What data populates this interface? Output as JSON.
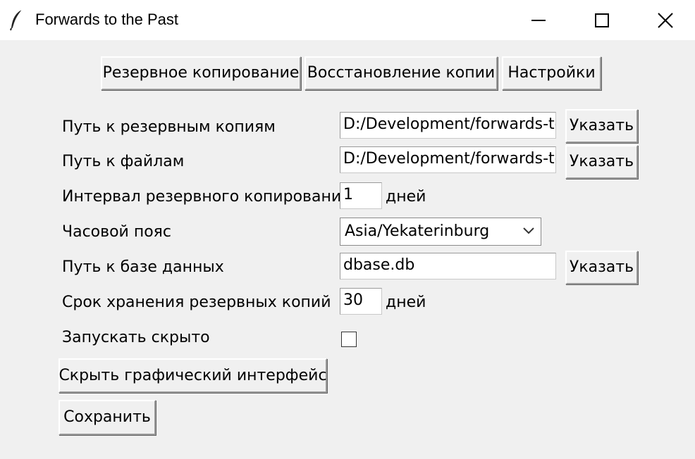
{
  "window": {
    "title": "Forwards to the Past",
    "icon": "feather-icon",
    "controls": [
      "minimize-icon",
      "maximize-icon",
      "close-icon"
    ]
  },
  "tabs": [
    {
      "label": "Резервное копирование"
    },
    {
      "label": "Восстановление копии"
    },
    {
      "label": "Настройки"
    }
  ],
  "settings": {
    "backup_path": {
      "label": "Путь к резервным копиям",
      "value": "D:/Development/forwards-tc",
      "button": "Указать"
    },
    "files_path": {
      "label": "Путь к файлам",
      "value": "D:/Development/forwards-tc",
      "button": "Указать"
    },
    "interval": {
      "label": "Интервал резервного копирования",
      "value": "1",
      "unit": "дней"
    },
    "timezone": {
      "label": "Часовой пояс",
      "value": "Asia/Yekaterinburg"
    },
    "db_path": {
      "label": "Путь к базе данных",
      "value": "dbase.db",
      "button": "Указать"
    },
    "retention": {
      "label": "Срок хранения резервных копий",
      "value": "30",
      "unit": "дней"
    },
    "hidden_start": {
      "label": "Запускать скрыто",
      "checked": false
    }
  },
  "actions": {
    "hide_gui": "Скрыть графический интерфейс",
    "save": "Сохранить"
  }
}
